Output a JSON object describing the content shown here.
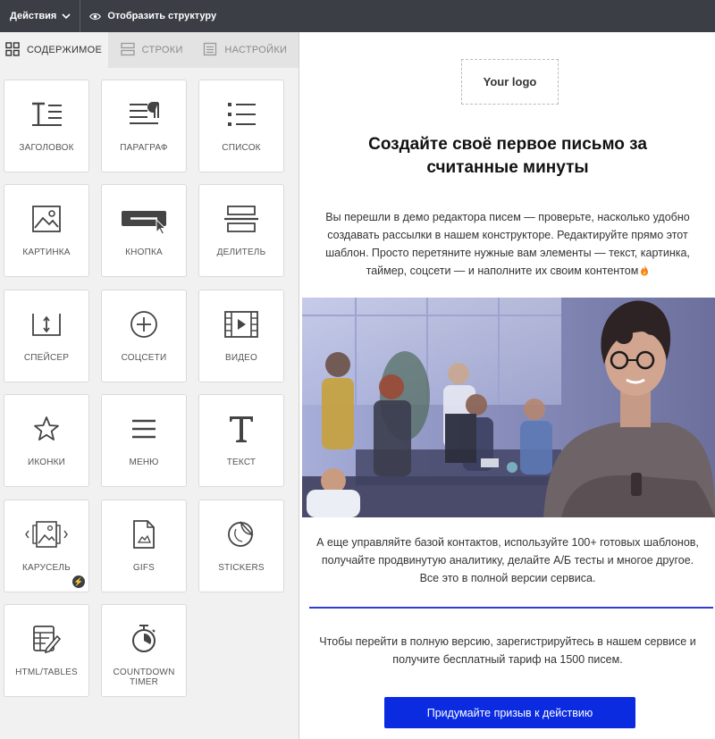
{
  "topbar": {
    "actions_label": "Действия",
    "structure_label": "Отобразить структуру"
  },
  "tabs": [
    {
      "label": "СОДЕРЖИМОЕ",
      "icon": "grid-icon",
      "active": true
    },
    {
      "label": "СТРОКИ",
      "icon": "rows-icon",
      "active": false
    },
    {
      "label": "НАСТРОЙКИ",
      "icon": "settings-panel-icon",
      "active": false
    }
  ],
  "blocks": [
    {
      "label": "ЗАГОЛОВОК",
      "icon": "heading-icon"
    },
    {
      "label": "ПАРАГРАФ",
      "icon": "paragraph-icon"
    },
    {
      "label": "СПИСОК",
      "icon": "list-icon"
    },
    {
      "label": "КАРТИНКА",
      "icon": "image-icon"
    },
    {
      "label": "КНОПКА",
      "icon": "button-icon"
    },
    {
      "label": "ДЕЛИТЕЛЬ",
      "icon": "divider-icon"
    },
    {
      "label": "СПЕЙСЕР",
      "icon": "spacer-icon"
    },
    {
      "label": "СОЦСЕТИ",
      "icon": "social-icon"
    },
    {
      "label": "ВИДЕО",
      "icon": "video-icon"
    },
    {
      "label": "ИКОНКИ",
      "icon": "star-icon"
    },
    {
      "label": "МЕНЮ",
      "icon": "menu-icon"
    },
    {
      "label": "ТЕКСТ",
      "icon": "text-icon"
    },
    {
      "label": "КАРУСЕЛЬ",
      "icon": "carousel-icon",
      "badge": "⚡"
    },
    {
      "label": "GIFS",
      "icon": "gifs-icon"
    },
    {
      "label": "STICKERS",
      "icon": "stickers-icon"
    },
    {
      "label": "HTML/TABLES",
      "icon": "html-tables-icon"
    },
    {
      "label": "COUNTDOWN TIMER",
      "icon": "timer-icon"
    }
  ],
  "preview": {
    "logo_text": "Your logo",
    "headline": "Создайте своё первое письмо за считанные минуты",
    "intro": "Вы перешли в демо редактора писем — проверьте, насколько удобно создавать рассылки в нашем конструкторе. Редактируйте прямо этот шаблон. Просто перетяните нужные вам элементы — текст, картинка, таймер, соцсети — и наполните их своим контентом",
    "intro_emoji": "fire-emoji",
    "paragraph2": "А еще управляйте базой контактов, используйте 100+ готовых шаблонов, получайте продвинутую аналитику, делайте А/Б тесты и многое другое. Все это в полной версии сервиса.",
    "paragraph3": "Чтобы перейти в полную версию, зарегистрируйтесь в нашем сервисе и получите бесплатный тариф на 1500 писем.",
    "cta_label": "Придумайте призыв к действию",
    "accent_color": "#0a2be0",
    "divider_color": "#2f3bd6"
  }
}
